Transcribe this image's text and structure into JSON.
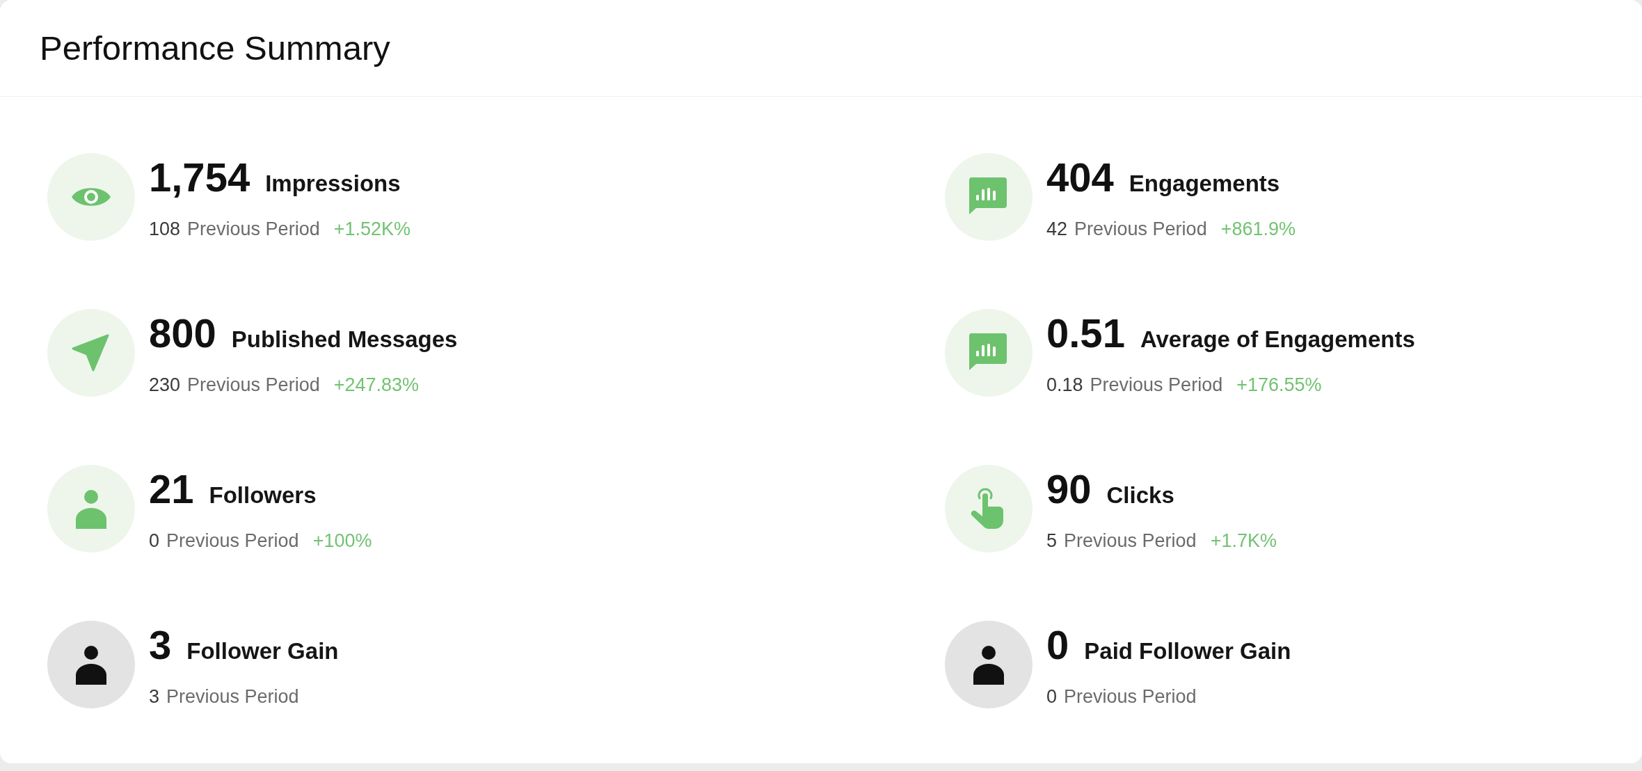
{
  "card": {
    "title": "Performance Summary"
  },
  "metrics": [
    {
      "kind": "reach",
      "value": "1,754",
      "label": "Impressions",
      "previous_value": "108",
      "previous_label": "Previous Period",
      "change": "+1.52K%"
    },
    {
      "kind": "engagement",
      "value": "404",
      "label": "Engagements",
      "previous_value": "42",
      "previous_label": "Previous Period",
      "change": "+861.9%"
    },
    {
      "kind": "publishing",
      "value": "800",
      "label": "Published Messages",
      "previous_value": "230",
      "previous_label": "Previous Period",
      "change": "+247.83%"
    },
    {
      "kind": "engagement",
      "value": "0.51",
      "label": "Average of Engagements",
      "previous_value": "0.18",
      "previous_label": "Previous Period",
      "change": "+176.55%"
    },
    {
      "kind": "audience",
      "value": "21",
      "label": "Followers",
      "previous_value": "0",
      "previous_label": "Previous Period",
      "change": "+100%"
    },
    {
      "kind": "clicks",
      "value": "90",
      "label": "Clicks",
      "previous_value": "5",
      "previous_label": "Previous Period",
      "change": "+1.7K%"
    },
    {
      "kind": "gain",
      "value": "3",
      "label": "Follower Gain",
      "previous_value": "3",
      "previous_label": "Previous Period"
    },
    {
      "kind": "gain",
      "value": "0",
      "label": "Paid Follower Gain",
      "previous_value": "0",
      "previous_label": "Previous Period"
    }
  ]
}
